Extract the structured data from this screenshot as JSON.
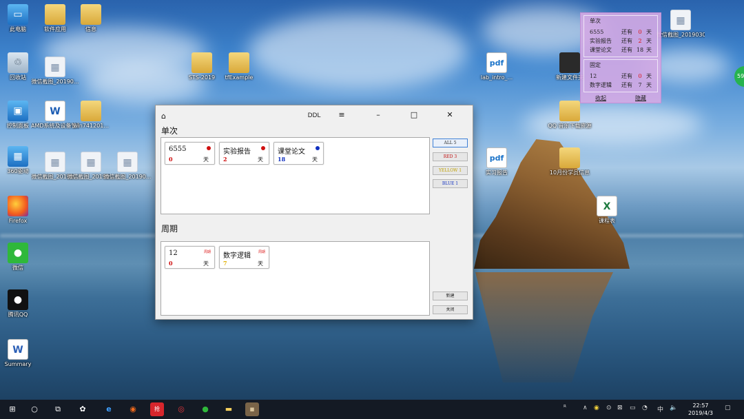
{
  "desktop": {
    "icons": [
      {
        "label": "此电脑",
        "glyph": "▭"
      },
      {
        "label": "软件应用",
        "glyph": ""
      },
      {
        "label": "信息",
        "glyph": ""
      },
      {
        "label": "回收站",
        "glyph": "♲"
      },
      {
        "label": "微信截图_20190...",
        "glyph": "▦"
      },
      {
        "label": "STS-2019",
        "glyph": ""
      },
      {
        "label": "tfExample",
        "glyph": ""
      },
      {
        "label": "控制面板",
        "glyph": "▣"
      },
      {
        "label": "AMD系统及设备管理文件",
        "glyph": "W"
      },
      {
        "label": "win741201...",
        "glyph": ""
      },
      {
        "label": "360驱动",
        "glyph": "▦"
      },
      {
        "label": "微信截图_20190...",
        "glyph": "▦"
      },
      {
        "label": "微信截图_20190...",
        "glyph": "▦"
      },
      {
        "label": "微信截图_20190...",
        "glyph": "▦"
      },
      {
        "label": "Firefox",
        "glyph": ""
      },
      {
        "label": "微信",
        "glyph": "●"
      },
      {
        "label": "腾讯QQ",
        "glyph": "●"
      },
      {
        "label": "Summary",
        "glyph": "W"
      },
      {
        "label": "lab_intro_...",
        "glyph": "pdf"
      },
      {
        "label": "新建文件夹",
        "glyph": ""
      },
      {
        "label": "QQ 音乐下载资源",
        "glyph": ""
      },
      {
        "label": "微信截图_2019030...",
        "glyph": "▦"
      },
      {
        "label": "实习报告",
        "glyph": "pdf"
      },
      {
        "label": "10月份学员信息",
        "glyph": ""
      },
      {
        "label": "课程表",
        "glyph": "X"
      }
    ]
  },
  "widget": {
    "single_title": "单次",
    "single_rows": [
      {
        "name": "6555",
        "has": "还有",
        "value": "0",
        "unit": "天"
      },
      {
        "name": "实验报告",
        "has": "还有",
        "value": "2",
        "unit": "天"
      },
      {
        "name": "课堂论文",
        "has": "还有",
        "value": "18",
        "unit": "天"
      }
    ],
    "fixed_title": "固定",
    "fixed_rows": [
      {
        "name": "12",
        "has": "还有",
        "value": "0",
        "unit": "天"
      },
      {
        "name": "数字逻辑",
        "has": "还有",
        "value": "7",
        "unit": "天"
      }
    ],
    "link_left": "收起",
    "link_right": "隐藏",
    "badge": "59"
  },
  "window": {
    "title": "DDL",
    "home_icon": "⌂",
    "menu_icon": "≡",
    "min_icon": "–",
    "max_icon": "□",
    "close_icon": "✕",
    "single_label": "单次",
    "periodic_label": "周期",
    "single_cards": [
      {
        "name": "6555",
        "num": "0",
        "day": "天",
        "dot": "#d01010",
        "num_color": "#d01010"
      },
      {
        "name": "实验报告",
        "num": "2",
        "day": "天",
        "dot": "#d01010",
        "num_color": "#d01010"
      },
      {
        "name": "课堂论文",
        "num": "18",
        "day": "天",
        "dot": "#1030c0",
        "num_color": "#1030c0"
      }
    ],
    "periodic_cards": [
      {
        "name": "12",
        "num": "0",
        "day": "天",
        "tag": "周期",
        "num_color": "#d01010"
      },
      {
        "name": "数字逻辑",
        "num": "7",
        "day": "天",
        "tag": "周期",
        "num_color": "#e0b000"
      }
    ],
    "filters": [
      {
        "label": "ALL 5",
        "color": "#222"
      },
      {
        "label": "RED 3",
        "color": "#c01010"
      },
      {
        "label": "YELLOW 1",
        "color": "#c0a000"
      },
      {
        "label": "BLUE 1",
        "color": "#1030c0"
      }
    ],
    "new_button": "新建",
    "close_button": "关闭"
  },
  "taskbar": {
    "start_icon": "⊞",
    "search_icon": "○",
    "taskview_icon": "⧉",
    "apps": [
      "✿",
      "e",
      "◉",
      "抢",
      "◎",
      "●",
      "▬",
      "▪"
    ],
    "tray": [
      "ᴿ",
      "∧",
      "◉",
      "⊙",
      "⊠",
      "▭",
      "◔",
      "🔈"
    ],
    "ime": "中",
    "time": "22:57",
    "date": "2019/4/3",
    "notify_icon": "▢"
  },
  "colors": {
    "accent_red": "#d01010",
    "accent_blue": "#1030c0",
    "accent_yellow": "#e0b000",
    "widget_bg": "#d4aae4"
  }
}
